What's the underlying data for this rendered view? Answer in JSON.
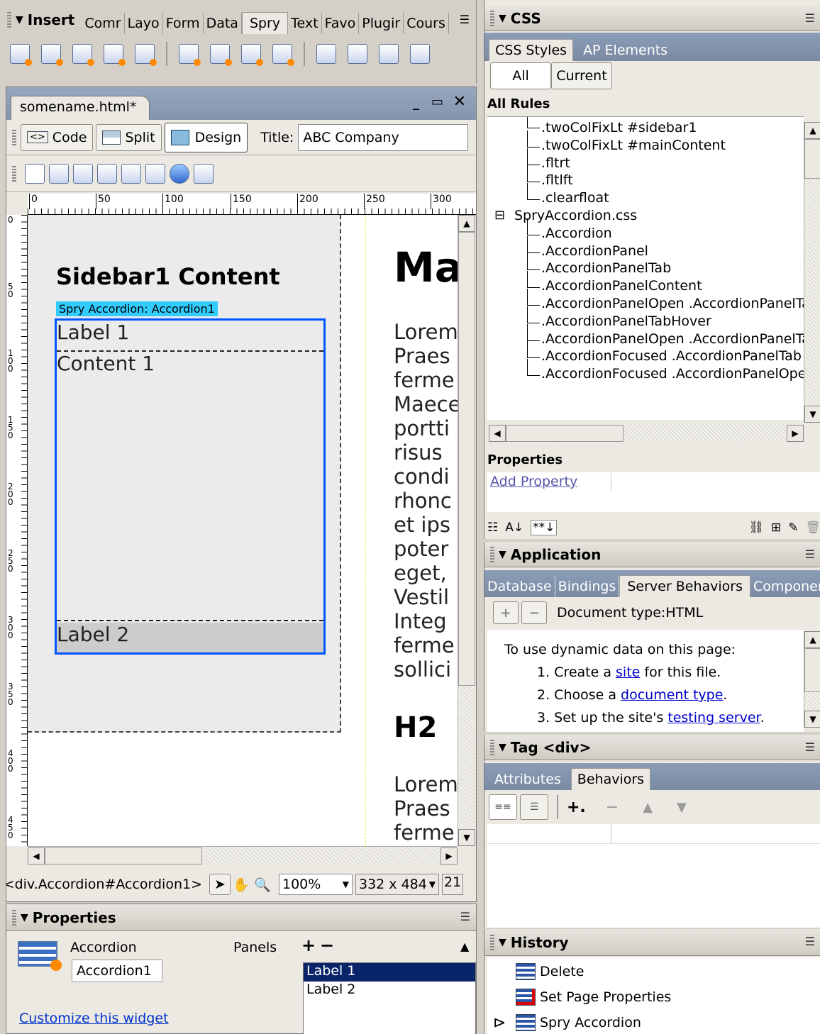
{
  "insert_panel": {
    "title": "Insert",
    "tabs": [
      "Comr",
      "Layo",
      "Form",
      "Data",
      "Spry",
      "Text",
      "Favo",
      "Plugir",
      "Cours"
    ],
    "active_tab": "Spry"
  },
  "document": {
    "tab_name": "somename.html*",
    "view_buttons": {
      "code": "Code",
      "split": "Split",
      "design": "Design"
    },
    "title_label": "Title:",
    "title_value": "ABC Company",
    "ruler_h": [
      "0",
      "50",
      "100",
      "150",
      "200",
      "250",
      "300"
    ],
    "ruler_v": [
      "0",
      "50",
      "100",
      "150",
      "200",
      "250",
      "300",
      "350",
      "400",
      "450"
    ],
    "sidebar_heading": "Sidebar1 Content",
    "spry_badge": "Spry Accordion: Accordion1",
    "accordion": {
      "label1": "Label 1",
      "content1": "Content 1",
      "label2": "Label 2"
    },
    "main_heading": "Ma",
    "main_lines": [
      "Lorem",
      "Praes",
      "ferme",
      "Maece",
      "portti",
      "risus",
      "condi",
      "rhonc",
      "et ips",
      "poter",
      "eget,",
      "Vestil",
      "Integ",
      "ferme",
      "sollici"
    ],
    "h2": "H2",
    "main_lines2": [
      "Lorem",
      "Praes",
      "ferme"
    ]
  },
  "status_bar": {
    "tag_path": "<div.Accordion#Accordion1>",
    "zoom": "100%",
    "size": "332 x 484",
    "extra": "21"
  },
  "properties_panel": {
    "title": "Properties",
    "widget_type": "Accordion",
    "widget_name": "Accordion1",
    "panels_label": "Panels",
    "panels": [
      "Label 1",
      "Label 2"
    ],
    "customize_link": "Customize this widget"
  },
  "css_panel": {
    "title": "CSS",
    "tabs": [
      "CSS Styles",
      "AP Elements"
    ],
    "mode_all": "All",
    "mode_current": "Current",
    "rules_heading": "All Rules",
    "rules_top": [
      ".twoColFixLt #sidebar1",
      ".twoColFixLt #mainContent",
      ".fltrt",
      ".fltlft",
      ".clearfloat"
    ],
    "sheet_name": "SpryAccordion.css",
    "rules_sheet": [
      ".Accordion",
      ".AccordionPanel",
      ".AccordionPanelTab",
      ".AccordionPanelContent",
      ".AccordionPanelOpen .AccordionPanelTa",
      ".AccordionPanelTabHover",
      ".AccordionPanelOpen .AccordionPanelTa",
      ".AccordionFocused .AccordionPanelTab",
      ".AccordionFocused .AccordionPanelOpe"
    ],
    "properties_heading": "Properties",
    "add_property": "Add Property"
  },
  "application_panel": {
    "title": "Application",
    "tabs": [
      "Database",
      "Bindings",
      "Server Behaviors",
      "Componer"
    ],
    "active_tab": "Server Behaviors",
    "doc_type": "Document type:HTML",
    "intro": "To use dynamic data on this page:",
    "steps": [
      {
        "num": "1.",
        "pre": "Create a ",
        "link": "site",
        "post": " for this file."
      },
      {
        "num": "2.",
        "pre": "Choose a ",
        "link": "document type",
        "post": "."
      },
      {
        "num": "3.",
        "pre": "Set up the site's ",
        "link": "testing server",
        "post": "."
      }
    ]
  },
  "tag_panel": {
    "title": "Tag <div>",
    "tabs": [
      "Attributes",
      "Behaviors"
    ],
    "active_tab": "Behaviors"
  },
  "history_panel": {
    "title": "History",
    "items": [
      "Delete",
      "Set Page Properties",
      "Spry Accordion"
    ]
  }
}
